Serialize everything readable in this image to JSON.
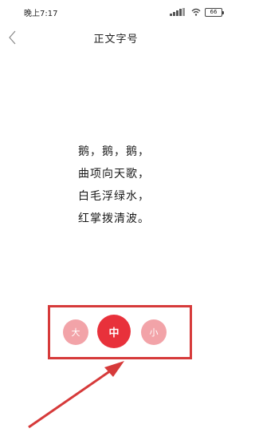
{
  "status_bar": {
    "time": "晚上7:17",
    "battery": "66"
  },
  "header": {
    "title": "正文字号"
  },
  "poem": {
    "lines": [
      "鹅，鹅，鹅，",
      "曲项向天歌，",
      "白毛浮绿水，",
      "红掌拨清波。"
    ]
  },
  "font_size_options": {
    "large": "大",
    "medium": "中",
    "small": "小",
    "selected": "medium"
  },
  "colors": {
    "accent": "#e8313b",
    "inactive": "#f2a3a8",
    "annotation": "#d63a3a"
  }
}
